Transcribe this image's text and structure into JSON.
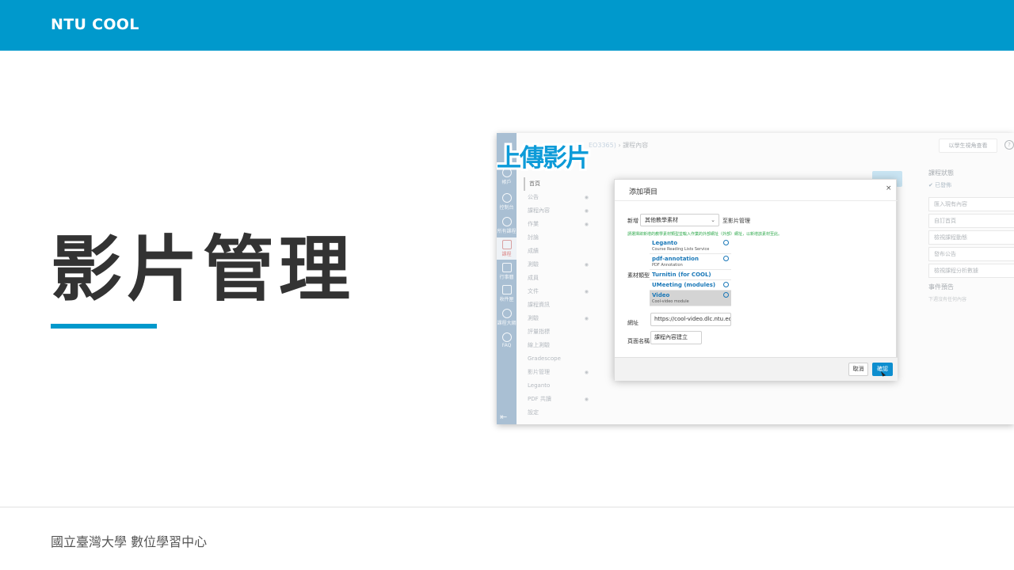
{
  "header": {
    "brand": "NTU COOL"
  },
  "main": {
    "title": "影片管理"
  },
  "footer": {
    "org": "國立臺灣大學 數位學習中心"
  },
  "colors": {
    "brand": "#0099cc",
    "primary_button": "#0d8ecf",
    "link": "#1a78b8",
    "hint_green": "#2aa748"
  },
  "screenshot": {
    "overlay_title": "上傳影片",
    "breadcrumb": {
      "course_id": "EO3365)",
      "separator": "›",
      "page": "課程內容"
    },
    "left_nav": [
      {
        "label": "帳戶",
        "icon": "user-icon"
      },
      {
        "label": "控制台",
        "icon": "dashboard-icon"
      },
      {
        "label": "所有課程",
        "icon": "courses-icon"
      },
      {
        "label": "課程",
        "icon": "course-icon"
      },
      {
        "label": "行事曆",
        "icon": "calendar-icon"
      },
      {
        "label": "收件匣",
        "icon": "inbox-icon"
      },
      {
        "label": "課程大綱",
        "icon": "plus-circle-icon"
      },
      {
        "label": "FAQ",
        "icon": "help-icon"
      }
    ],
    "course_nav": [
      "首頁",
      "公告",
      "課程內容",
      "作業",
      "討論",
      "成績",
      "測驗",
      "成員",
      "文件",
      "課程資訊",
      "測驗",
      "評量指標",
      "線上測驗",
      "Gradescope",
      "影片管理",
      "Leganto",
      "PDF 共讀",
      "設定"
    ],
    "right_panel": {
      "status_heading": "課程狀態",
      "status": "已發佈",
      "buttons": [
        "匯入現有內容",
        "自訂首頁",
        "檢視課程動態",
        "發布公告",
        "檢視課程分析數據"
      ],
      "todo_heading": "事件預告",
      "todo_sub": "下週沒有任何內容"
    },
    "student_view": "以學生視角查看",
    "dialog": {
      "title": "添加項目",
      "close": "×",
      "add_label": "新增",
      "type_selected": "其他教學素材",
      "add_suffix": "至影片管理",
      "hint": "請選擇欲新增的教學素材類型並輸入作業的外部網址（外部）網址，以新增該素材至此。",
      "material_label": "素材類型",
      "options": [
        {
          "name": "Leganto",
          "sub": "Course Reading Lists Service",
          "icon": "search-icon"
        },
        {
          "name": "pdf-annotation",
          "sub": "PDF Annotation",
          "icon": "search-icon"
        },
        {
          "name": "Turnitin (for COOL)",
          "sub": "",
          "icon": ""
        },
        {
          "name": "UMeeting (modules)",
          "sub": "",
          "icon": "search-icon"
        },
        {
          "name": "Video",
          "sub": "Cool-video module",
          "icon": "search-icon"
        }
      ],
      "url_label": "網址",
      "url_value": "https://cool-video.dlc.ntu.edu.tw",
      "page_name_label": "頁面名稱",
      "page_name_value": "課程內容建立",
      "cancel": "取消",
      "confirm": "確認"
    }
  }
}
